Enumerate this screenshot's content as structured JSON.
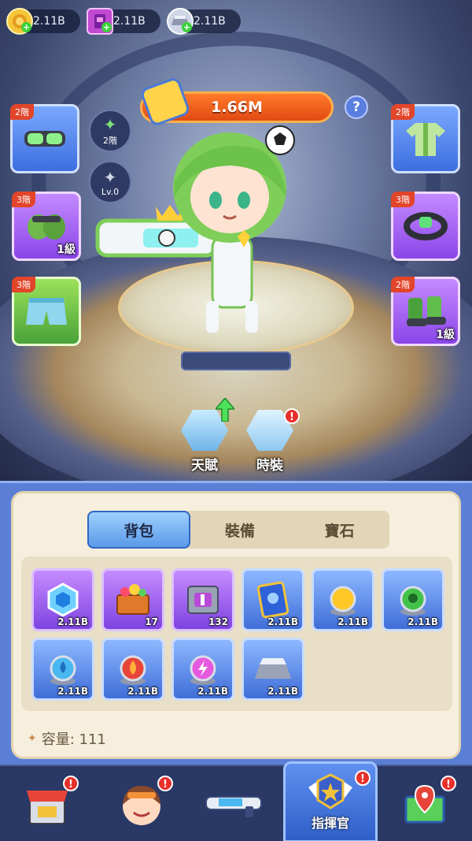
{
  "resources": [
    {
      "name": "lion-coin-icon",
      "value": "2.11B",
      "color": "#f5c53a"
    },
    {
      "name": "purple-book-icon",
      "value": "2.11B",
      "color": "#c14ad0"
    },
    {
      "name": "silver-ingot-icon",
      "value": "2.11B",
      "color": "#cfd6e6"
    }
  ],
  "power": "1.66M",
  "help_glyph": "?",
  "slots": {
    "left": [
      {
        "tier": "2階",
        "level": "",
        "icon": "goggles-icon",
        "color": "blue"
      },
      {
        "tier": "3階",
        "level": "1級",
        "icon": "gloves-icon",
        "color": "purple"
      },
      {
        "tier": "3階",
        "level": "",
        "icon": "shorts-icon",
        "color": "green"
      }
    ],
    "right": [
      {
        "tier": "2階",
        "level": "",
        "icon": "jersey-icon",
        "color": "blue"
      },
      {
        "tier": "3階",
        "level": "",
        "icon": "bracelet-icon",
        "color": "purple"
      },
      {
        "tier": "2階",
        "level": "1級",
        "icon": "boots-icon",
        "color": "purple"
      }
    ]
  },
  "medals": [
    {
      "icon": "green-medal-icon",
      "text": "2階"
    },
    {
      "icon": "silver-star-icon",
      "text": "Lv.0"
    }
  ],
  "actions": [
    {
      "label": "天賦",
      "icon": "talent-icon",
      "upgrade": true,
      "alert": false
    },
    {
      "label": "時裝",
      "icon": "costume-icon",
      "upgrade": false,
      "alert": true
    }
  ],
  "alert_glyph": "!",
  "tabs": [
    {
      "label": "背包",
      "active": true
    },
    {
      "label": "裝備",
      "active": false
    },
    {
      "label": "寶石",
      "active": false
    }
  ],
  "items": [
    {
      "icon": "blue-gem-frame-icon",
      "count": "2.11B",
      "rarity": "purple"
    },
    {
      "icon": "treasure-chest-icon",
      "count": "17",
      "rarity": "purple"
    },
    {
      "icon": "hammer-box-icon",
      "count": "132",
      "rarity": "purple"
    },
    {
      "icon": "blue-book-icon",
      "count": "2.11B",
      "rarity": "blue"
    },
    {
      "icon": "yellow-orb-icon",
      "count": "2.11B",
      "rarity": "blue"
    },
    {
      "icon": "green-skull-orb-icon",
      "count": "2.11B",
      "rarity": "blue"
    },
    {
      "icon": "water-orb-icon",
      "count": "2.11B",
      "rarity": "blue"
    },
    {
      "icon": "fire-orb-icon",
      "count": "2.11B",
      "rarity": "blue"
    },
    {
      "icon": "lightning-orb-icon",
      "count": "2.11B",
      "rarity": "blue"
    },
    {
      "icon": "silver-ingot-icon",
      "count": "2.11B",
      "rarity": "blue"
    }
  ],
  "capacity": "容量: 111",
  "nav": [
    {
      "icon": "shop-icon",
      "label": "",
      "alert": true,
      "active": false
    },
    {
      "icon": "character-face-icon",
      "label": "",
      "alert": true,
      "active": false
    },
    {
      "icon": "blaster-gun-icon",
      "label": "",
      "alert": false,
      "active": false
    },
    {
      "icon": "commander-badge-icon",
      "label": "指揮官",
      "alert": true,
      "active": true
    },
    {
      "icon": "map-pin-icon",
      "label": "",
      "alert": true,
      "active": false
    }
  ]
}
